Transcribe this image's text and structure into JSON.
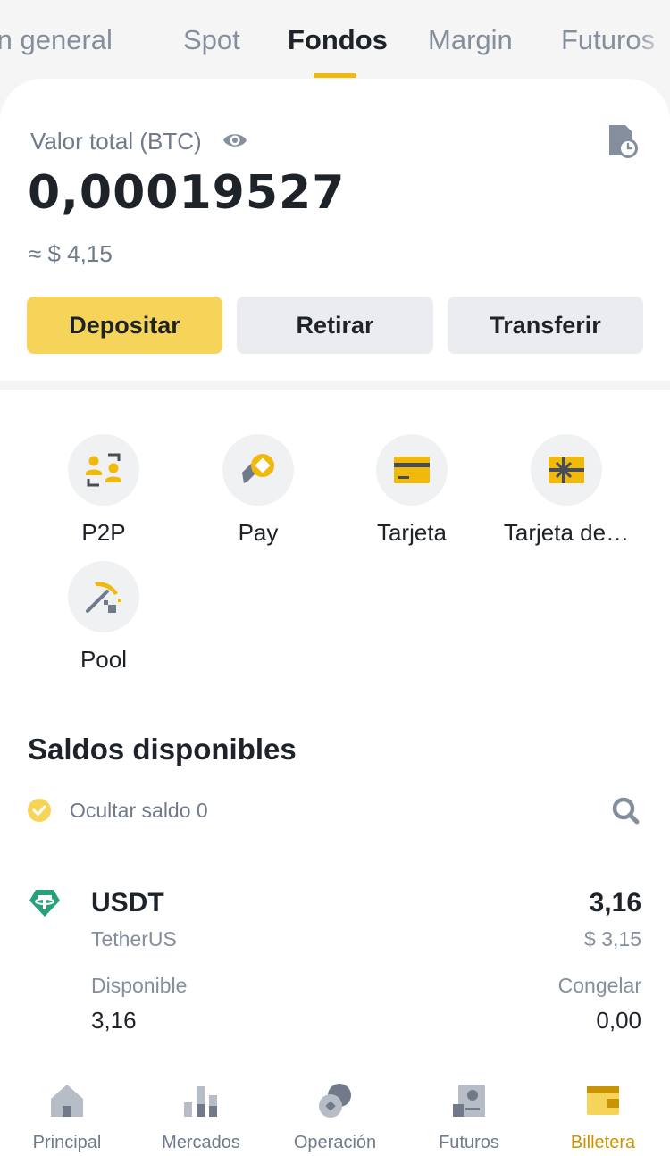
{
  "tabs": [
    {
      "label": "Visión general"
    },
    {
      "label": "Spot"
    },
    {
      "label": "Fondos"
    },
    {
      "label": "Margin"
    },
    {
      "label": "Futuros"
    }
  ],
  "active_tab": "Fondos",
  "summary": {
    "label": "Valor total (BTC)",
    "value": "0,00019527",
    "usd": "≈ $ 4,15"
  },
  "actions": {
    "deposit": "Depositar",
    "withdraw": "Retirar",
    "transfer": "Transferir"
  },
  "shortcuts": [
    {
      "label": "P2P",
      "icon": "p2p-icon"
    },
    {
      "label": "Pay",
      "icon": "pay-icon"
    },
    {
      "label": "Tarjeta",
      "icon": "card-icon"
    },
    {
      "label": "Tarjeta de…",
      "icon": "gift-card-icon"
    },
    {
      "label": "Pool",
      "icon": "pickaxe-icon"
    }
  ],
  "balances": {
    "title": "Saldos disponibles",
    "hide_zero_label": "Ocultar saldo 0",
    "assets": [
      {
        "symbol": "USDT",
        "name": "TetherUS",
        "amount": "3,16",
        "usd": "$ 3,15",
        "available_label": "Disponible",
        "available": "3,16",
        "frozen_label": "Congelar",
        "frozen": "0,00"
      }
    ]
  },
  "bottom_nav": [
    {
      "label": "Principal",
      "icon": "home-icon"
    },
    {
      "label": "Mercados",
      "icon": "markets-icon"
    },
    {
      "label": "Operación",
      "icon": "trade-icon"
    },
    {
      "label": "Futuros",
      "icon": "futures-icon"
    },
    {
      "label": "Billetera",
      "icon": "wallet-icon"
    }
  ],
  "active_nav": "Billetera",
  "colors": {
    "accent": "#f0b90b",
    "button_primary": "#f6d459",
    "button_secondary": "#eaecef",
    "text_primary": "#1e2329",
    "text_secondary": "#707a8a",
    "active_nav": "#c99400",
    "tether": "#26a17b"
  }
}
